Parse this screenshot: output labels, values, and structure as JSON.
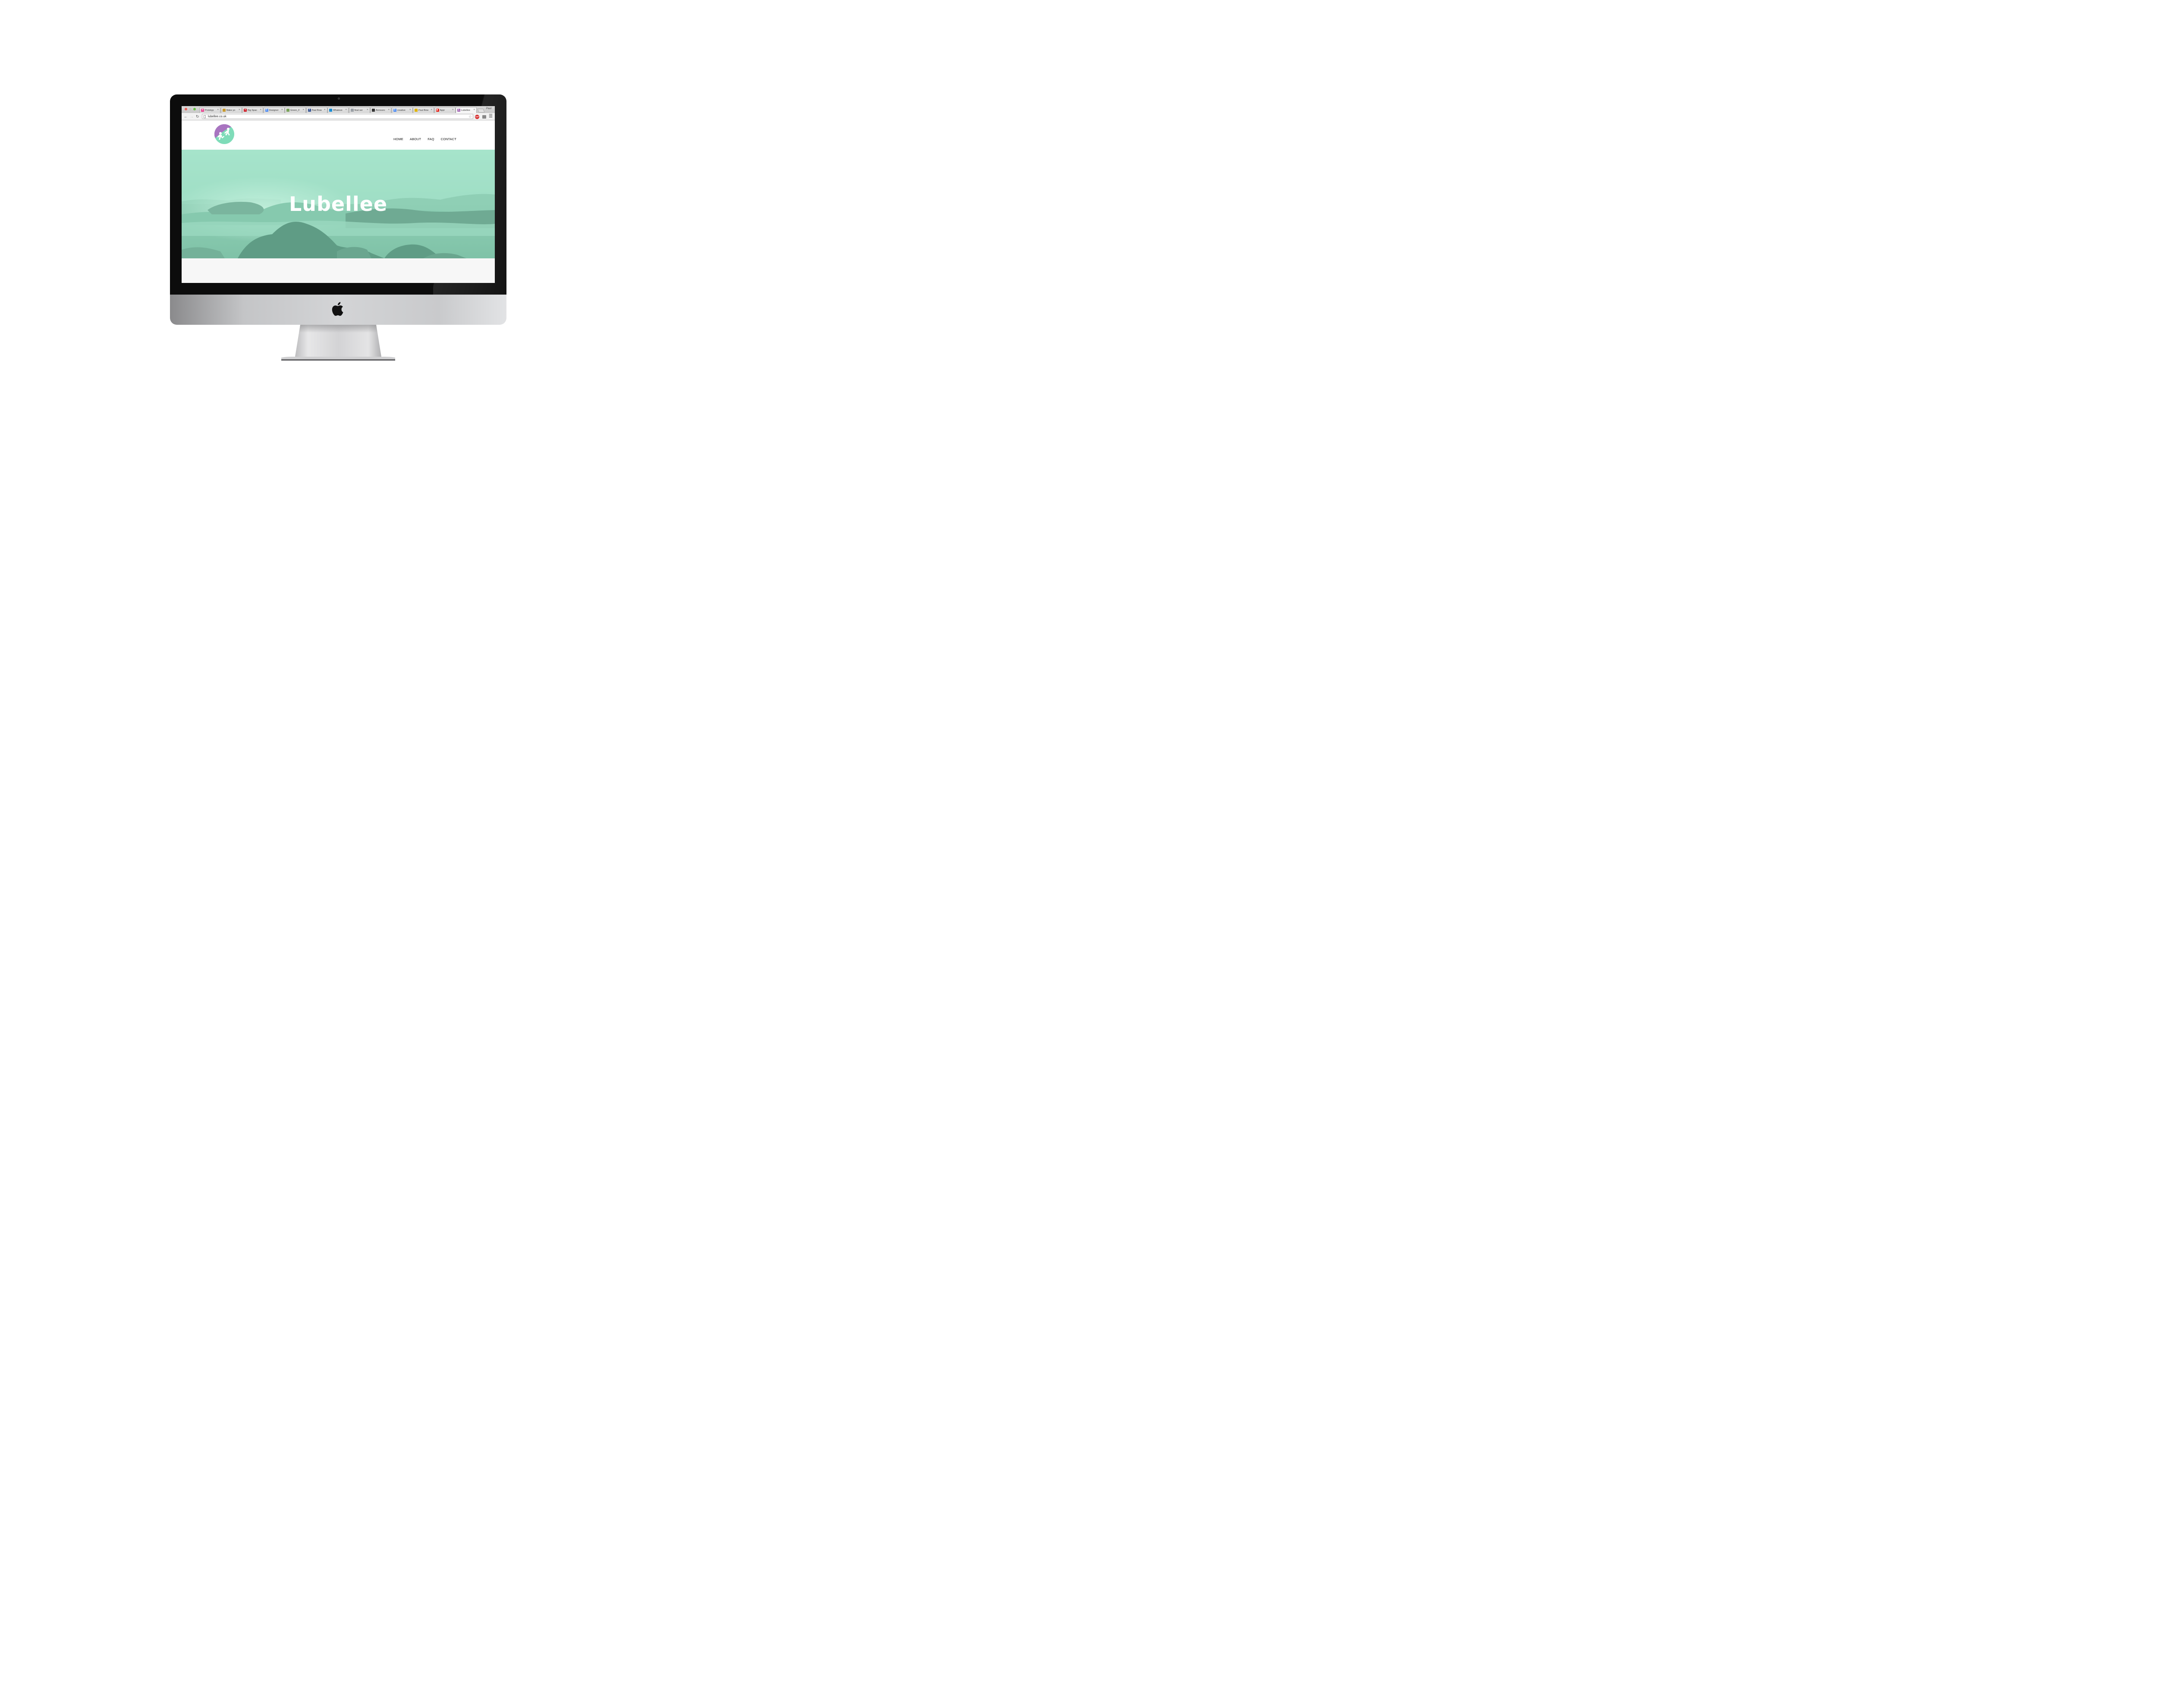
{
  "browser": {
    "tabs": [
      {
        "label": "Prototyp",
        "favicon_color": "#e8388a",
        "favicon_glyph": "in",
        "active": false
      },
      {
        "label": "Make yo",
        "favicon_color": "#c99a2e",
        "favicon_glyph": "",
        "active": false
      },
      {
        "label": "Big Spac",
        "favicon_color": "#d0202a",
        "favicon_glyph": "♥",
        "active": false
      },
      {
        "label": "Designer",
        "favicon_color": "#4a8af4",
        "favicon_glyph": "G",
        "active": false
      },
      {
        "label": "Green_F",
        "favicon_color": "#7aa35a",
        "favicon_glyph": "",
        "active": false
      },
      {
        "label": "Paul Bow",
        "favicon_color": "#3b5998",
        "favicon_glyph": "f",
        "active": false
      },
      {
        "label": "Whateve",
        "favicon_color": "#1b8fd6",
        "favicon_glyph": "",
        "active": false
      },
      {
        "label": "final ser",
        "favicon_color": "#9aa0a6",
        "favicon_glyph": "",
        "active": false
      },
      {
        "label": "Announc",
        "favicon_color": "#333333",
        "favicon_glyph": "",
        "active": false
      },
      {
        "label": "creative",
        "favicon_color": "#4a8af4",
        "favicon_glyph": "G",
        "active": false
      },
      {
        "label": "Paul Bow",
        "favicon_color": "#e0b400",
        "favicon_glyph": "",
        "active": false
      },
      {
        "label": "Appr",
        "favicon_color": "#e62117",
        "favicon_glyph": "▶",
        "active": false
      },
      {
        "label": "Lubellee",
        "favicon_color": "#a66bb8",
        "favicon_glyph": "L",
        "active": true
      }
    ],
    "tab_close_glyph": "×",
    "profile_name": "Paul",
    "url": "lubellee.co.uk",
    "extension_label": "ABP"
  },
  "site": {
    "nav": {
      "home": "HOME",
      "about": "ABOUT",
      "faq": "FAQ",
      "contact": "CONTACT"
    },
    "hero_title": "Lubellee",
    "colors": {
      "hero_tint": "#a3e2c8",
      "logo_purple": "#a874c0",
      "logo_teal": "#7fdcb9"
    }
  },
  "icons": {
    "back": "arrow-left-icon",
    "forward": "arrow-right-icon",
    "reload": "reload-icon",
    "bookmark": "star-icon",
    "menu": "hamburger-menu-icon",
    "hardware_logo": "apple-logo-icon"
  }
}
